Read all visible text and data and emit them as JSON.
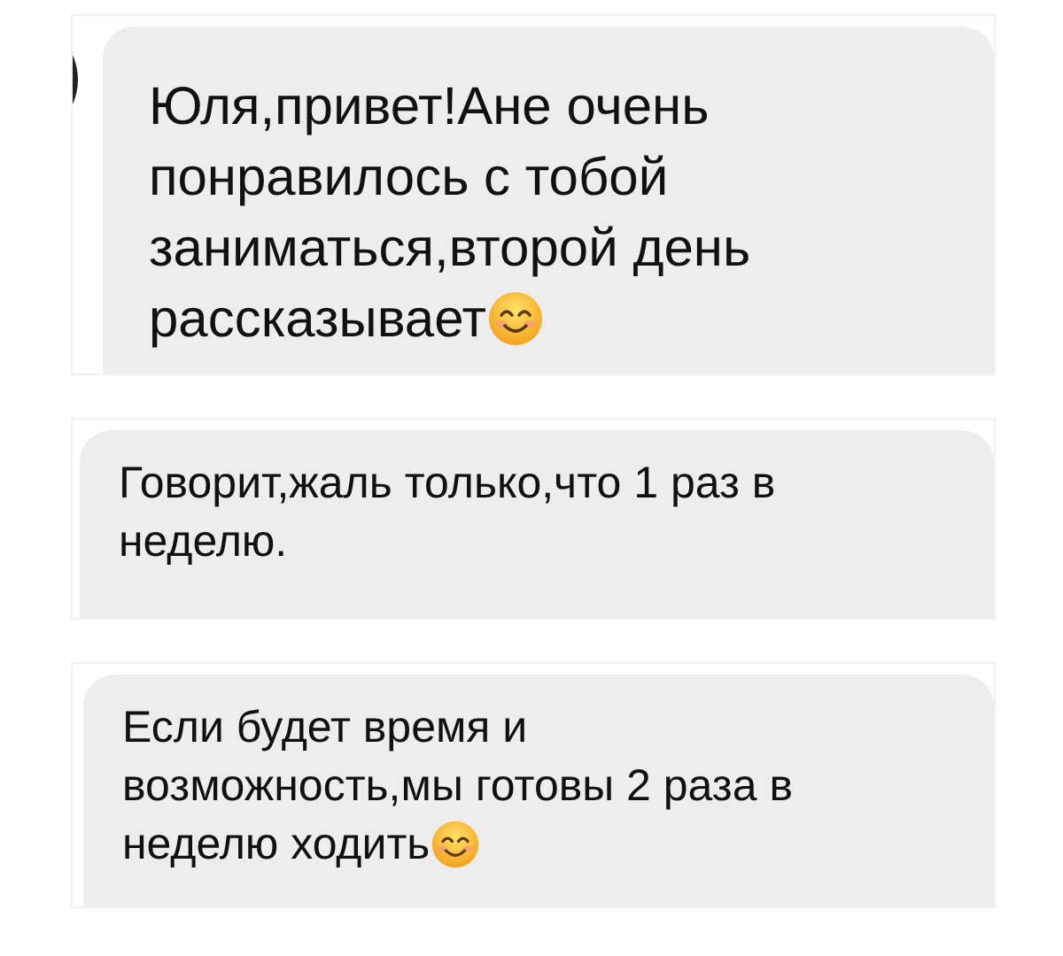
{
  "screenshots": [
    {
      "avatar_shown": true,
      "message": {
        "text": "Юля,привет!Ане очень понравилось с тобой заниматься,второй день рассказывает",
        "emoji": true
      }
    },
    {
      "avatar_shown": false,
      "message": {
        "text": "Говорит,жаль только,что 1 раз в неделю.",
        "emoji": false
      }
    },
    {
      "avatar_shown": false,
      "message": {
        "text": "Если будет время и возможность,мы готовы 2 раза в неделю ходить",
        "emoji": true
      }
    }
  ]
}
